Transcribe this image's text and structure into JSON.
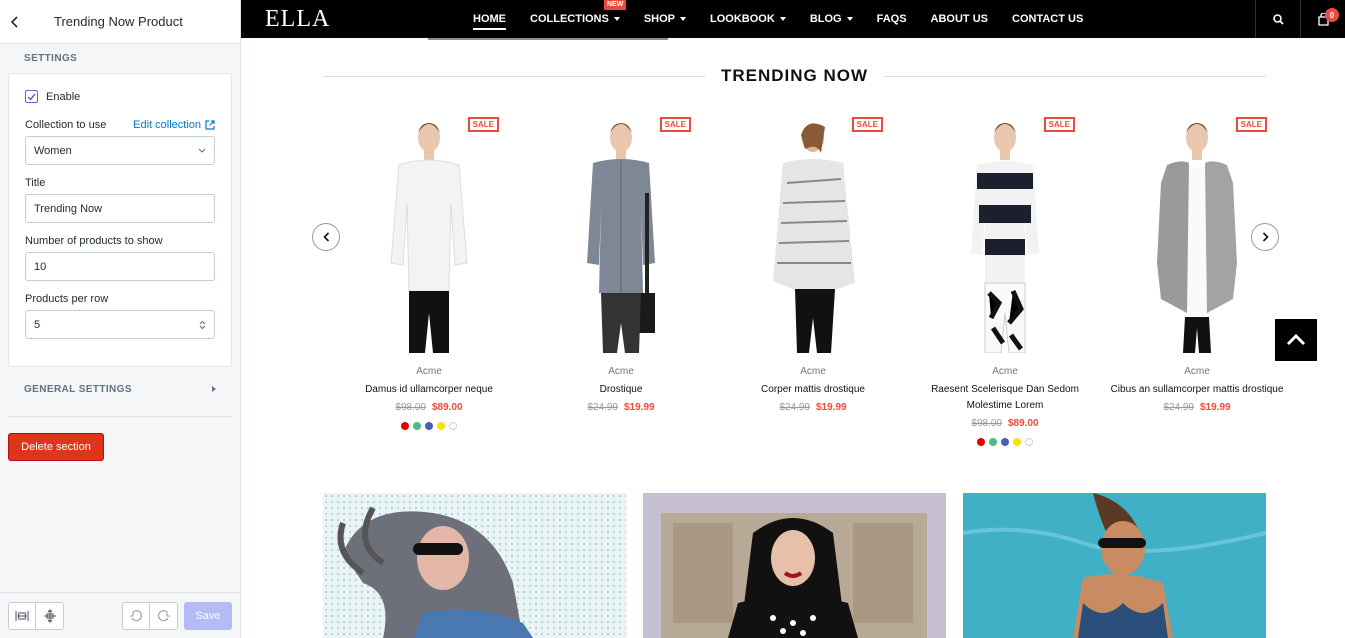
{
  "sidebar": {
    "title": "Trending Now Product",
    "section_label": "SETTINGS",
    "enable_label": "Enable",
    "collection_label": "Collection to use",
    "edit_collection_link": "Edit collection",
    "collection_value": "Women",
    "title_label": "Title",
    "title_value": "Trending Now",
    "count_label": "Number of products to show",
    "count_value": "10",
    "per_row_label": "Products per row",
    "per_row_value": "5",
    "general_settings": "GENERAL SETTINGS",
    "delete_label": "Delete section",
    "save_label": "Save"
  },
  "store": {
    "logo": "ELLA",
    "menu": [
      {
        "label": "HOME",
        "active": true
      },
      {
        "label": "COLLECTIONS",
        "badge": "NEW"
      },
      {
        "label": "SHOP"
      },
      {
        "label": "LOOKBOOK"
      },
      {
        "label": "BLOG"
      },
      {
        "label": "FAQS"
      },
      {
        "label": "ABOUT US"
      },
      {
        "label": "CONTACT US"
      }
    ],
    "cart_count": "0",
    "section_title": "TRENDING NOW",
    "sale_badge": "SALE",
    "products": [
      {
        "vendor": "Acme",
        "name": "Damus id ullamcorper neque",
        "old_price": "$98.00",
        "price": "$89.00"
      },
      {
        "vendor": "Acme",
        "name": "Drostique",
        "old_price": "$24.99",
        "price": "$19.99"
      },
      {
        "vendor": "Acme",
        "name": "Corper mattis drostique",
        "old_price": "$24.99",
        "price": "$19.99"
      },
      {
        "vendor": "Acme",
        "name": "Raesent Scelerisque Dan Sedom Molestime Lorem",
        "old_price": "$98.00",
        "price": "$89.00"
      },
      {
        "vendor": "Acme",
        "name": "Cibus an sullamcorper mattis drostique",
        "old_price": "$24.99",
        "price": "$19.99"
      }
    ],
    "swatch_colors": [
      "#e60000",
      "#4cb88c",
      "#4a5fb5",
      "#f5e300",
      "#ffffff"
    ]
  },
  "colors": {
    "accent": "#5c6ac4",
    "danger": "#de3618",
    "sale": "#e74c3c"
  }
}
